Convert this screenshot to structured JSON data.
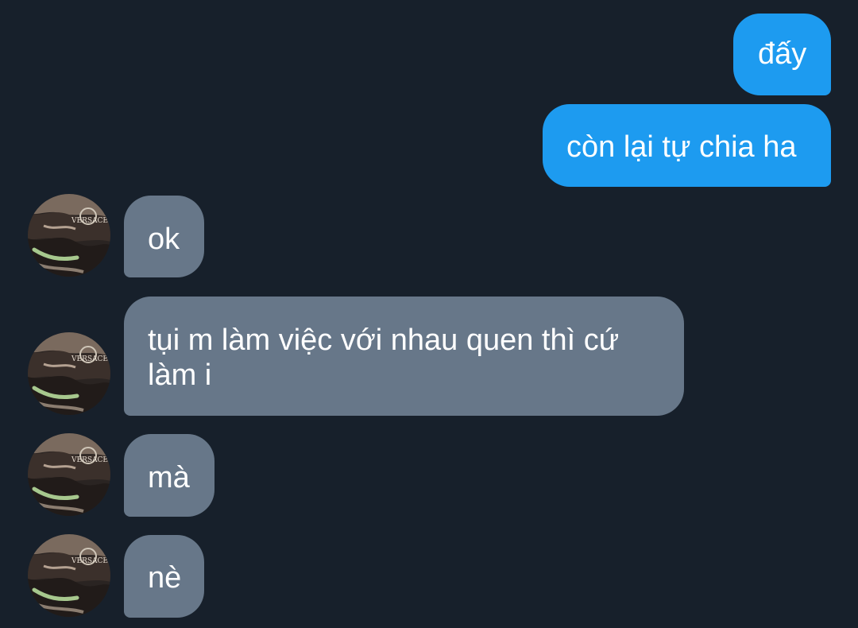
{
  "theme": {
    "background": "#17202b",
    "outgoing_bubble": "#1d9bf0",
    "incoming_bubble": "#677789",
    "text": "#ffffff"
  },
  "avatar": {
    "icon": "user-avatar-photo",
    "printed_text": "VERSACE"
  },
  "messages": [
    {
      "direction": "outgoing",
      "text": "đấy"
    },
    {
      "direction": "outgoing",
      "text": "còn lại tự chia ha"
    },
    {
      "direction": "incoming",
      "text": "ok"
    },
    {
      "direction": "incoming",
      "text": "tụi m làm việc với nhau quen thì cứ\nlàm i"
    },
    {
      "direction": "incoming",
      "text": "mà"
    },
    {
      "direction": "incoming",
      "text": "nè"
    }
  ]
}
